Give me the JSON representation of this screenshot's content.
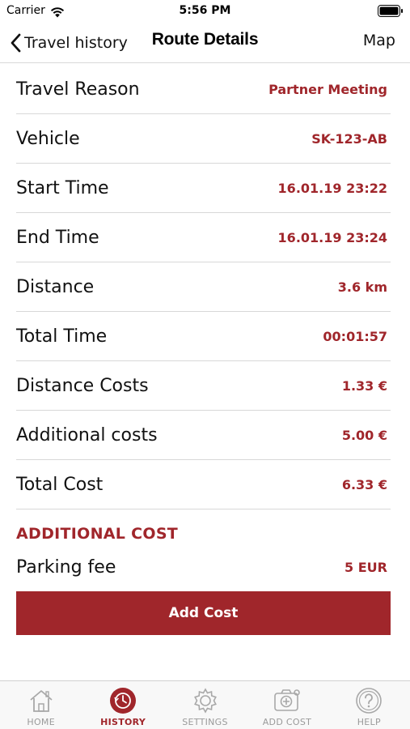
{
  "status_bar": {
    "carrier": "Carrier",
    "time": "5:56 PM"
  },
  "nav": {
    "back_label": "Travel history",
    "title": "Route Details",
    "right_label": "Map"
  },
  "details": [
    {
      "label": "Travel Reason",
      "value": "Partner Meeting"
    },
    {
      "label": "Vehicle",
      "value": "SK-123-AB"
    },
    {
      "label": "Start Time",
      "value": "16.01.19 23:22"
    },
    {
      "label": "End Time",
      "value": "16.01.19 23:24"
    },
    {
      "label": "Distance",
      "value": "3.6 km"
    },
    {
      "label": "Total Time",
      "value": "00:01:57"
    },
    {
      "label": "Distance Costs",
      "value": "1.33 €"
    },
    {
      "label": "Additional costs",
      "value": "5.00 €"
    },
    {
      "label": "Total Cost",
      "value": "6.33 €"
    }
  ],
  "additional": {
    "title": "ADDITIONAL COST",
    "items": [
      {
        "label": "Parking fee",
        "value": "5 EUR"
      }
    ],
    "button_label": "Add Cost"
  },
  "tabs": [
    {
      "label": "HOME",
      "icon": "home-icon",
      "active": false
    },
    {
      "label": "HISTORY",
      "icon": "history-icon",
      "active": true
    },
    {
      "label": "SETTINGS",
      "icon": "gear-icon",
      "active": false
    },
    {
      "label": "ADD COST",
      "icon": "add-cost-icon",
      "active": false
    },
    {
      "label": "HELP",
      "icon": "help-icon",
      "active": false
    }
  ],
  "colors": {
    "accent": "#a0262b",
    "inactive": "#9a9a9a"
  }
}
